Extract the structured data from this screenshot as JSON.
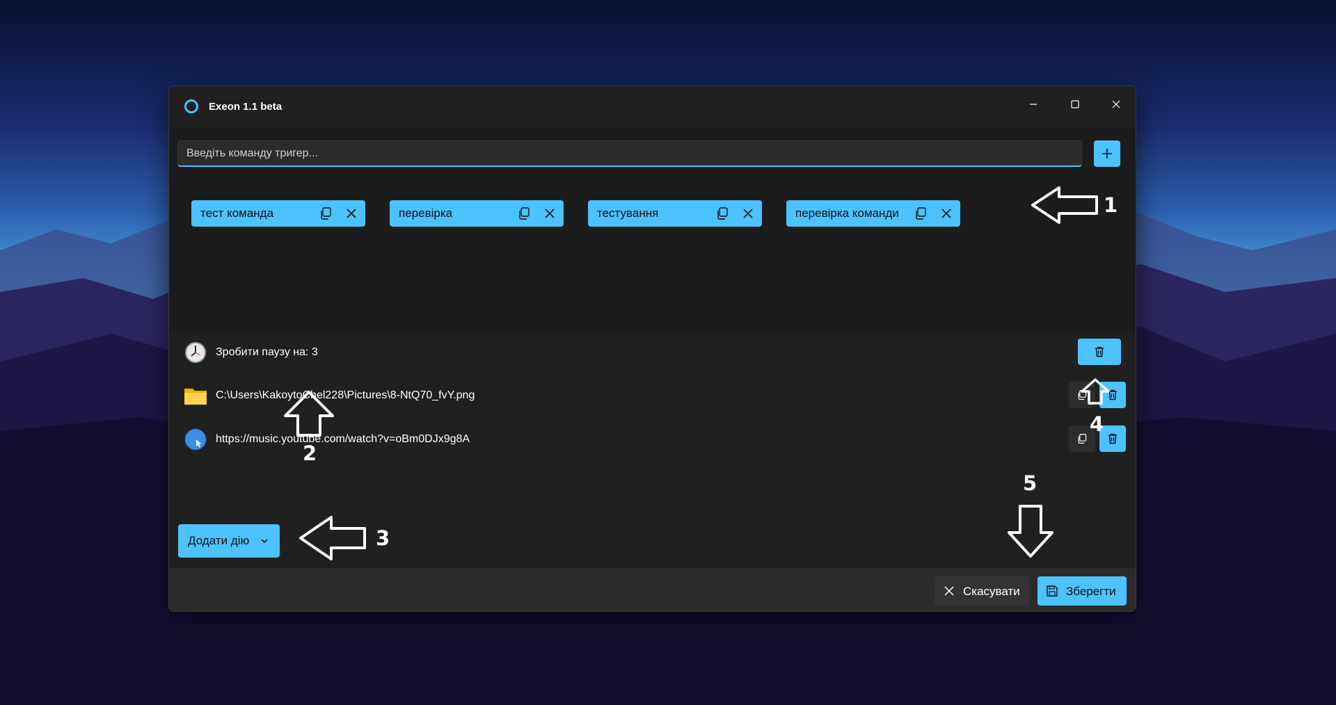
{
  "window": {
    "title": "Exeon 1.1 beta"
  },
  "command_input": {
    "placeholder": "Введіть команду тригер..."
  },
  "triggers": [
    {
      "label": "тест команда"
    },
    {
      "label": "перевірка"
    },
    {
      "label": "тестування"
    },
    {
      "label": "перевірка команди"
    }
  ],
  "actions": [
    {
      "type": "pause",
      "icon": "clock-icon",
      "text": "Зробити паузу на: 3"
    },
    {
      "type": "file",
      "icon": "folder-icon",
      "text": "C:\\Users\\KakoytoChel228\\Pictures\\8-NtQ70_fvY.png"
    },
    {
      "type": "url",
      "icon": "globe-icon",
      "text": "https://music.youtube.com/watch?v=oBm0DJx9g8A"
    }
  ],
  "add_action": {
    "label": "Додати дію"
  },
  "footer": {
    "cancel_label": "Скасувати",
    "save_label": "Зберегти"
  },
  "annotations": {
    "a1": "1",
    "a2": "2",
    "a3": "3",
    "a4": "4",
    "a5": "5"
  },
  "colors": {
    "accent": "#4cc2ff",
    "window_bg": "#202020",
    "panel_bg": "#1c1c1c",
    "footer_bg": "#2b2b2b"
  }
}
